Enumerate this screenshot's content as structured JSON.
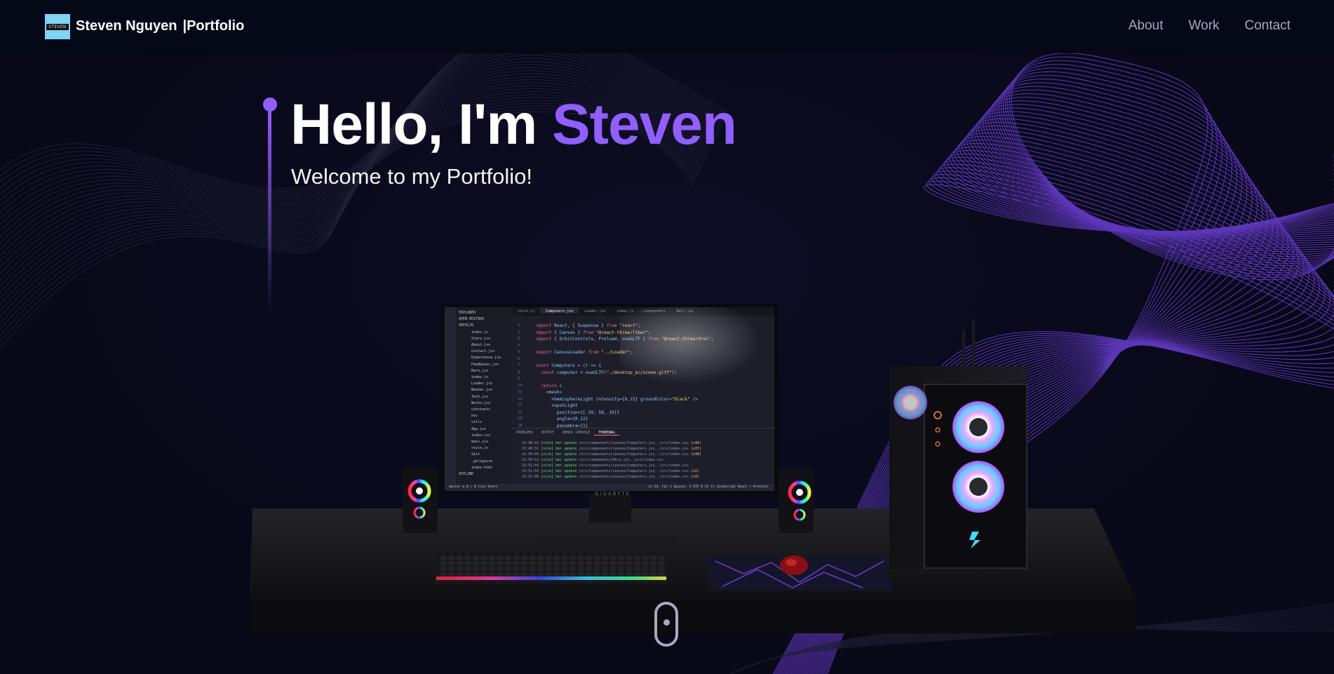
{
  "navbar": {
    "logo_text": "STEVEN",
    "brand_name": "Steven Nguyen",
    "brand_suffix": "|Portfolio",
    "links": [
      "About",
      "Work",
      "Contact"
    ]
  },
  "hero": {
    "greeting": "Hello, I'm ",
    "name": "Steven",
    "subtitle": "Welcome to my Portfolio!"
  },
  "editor": {
    "tabs": [
      "style.js",
      "Computers.jsx",
      "Loader.jsx",
      "index.js .../components",
      "Ball.jsx"
    ],
    "active_tab": "Computers.jsx",
    "explorer_title": "EXPLORER",
    "open_editors": "OPEN EDITORS",
    "project": "3DFOLIO",
    "files": [
      "index.js",
      "Stars.jsx",
      "About.jsx",
      "Contact.jsx",
      "Experience.jsx",
      "Feedbacks.jsx",
      "Hero.jsx",
      "index.js",
      "Loader.jsx",
      "Navbar.jsx",
      "Tech.jsx",
      "Works.jsx",
      "constants",
      "hoc",
      "utils",
      "App.jsx",
      "index.css",
      "main.jsx",
      "style.js",
      "dist",
      ".gitignore",
      "index.html"
    ],
    "outline": "OUTLINE",
    "code_lines": [
      "import React, { Suspense } from \"react\";",
      "import { Canvas } from \"@react-three/fiber\";",
      "import { OrbitControls, Preload, useGLTF } from \"@react-three/drei\";",
      "",
      "import CanvasLoader from \"../Loader\";",
      "",
      "const Computers = () => {",
      "  const computer = useGLTF(\"./desktop_pc/scene.gltf\");",
      "",
      "  return (",
      "    <mesh>",
      "      <hemisphereLight intensity={0.15} groundColor=\"black\" />",
      "      <spotLight",
      "        position={[-20, 50, 10]}",
      "        angle={0.12}",
      "        penumbra={1}"
    ],
    "panel_tabs": [
      "PROBLEMS",
      "OUTPUT",
      "DEBUG CONSOLE",
      "TERMINAL"
    ],
    "active_panel": "TERMINAL",
    "terminal_lines": [
      "22:48:42 [vite] hmr update /src/components/canvas/Computers.jsx, /src/index.css (x35)",
      "22:48:51 [vite] hmr update /src/components/canvas/Computers.jsx, /src/index.css (x37)",
      "22:50:09 [vite] hmr update /src/components/canvas/Computers.jsx, /src/index.css (x38)",
      "22:50:52 [vite] hmr update /src/components/Hero.jsx, /src/index.css",
      "22:51:04 [vite] hmr update /src/components/canvas/Computers.jsx, /src/index.css",
      "22:51:55 [vite] hmr update /src/components/canvas/Computers.jsx, /src/index.css (x2)",
      "22:52:09 [vite] hmr update /src/components/canvas/Computers.jsx, /src/index.css (x3)"
    ],
    "status_left": "master  ⊗ 0 ⚠ 0  Live Share",
    "status_right": "Ln 54, Col 1   Spaces: 2   UTF-8   LF   {} JavaScript React   ✓ Prettier",
    "monitor_brand": "GIGABYTE"
  },
  "colors": {
    "accent": "#915eff",
    "nav_link": "#aaa6c3",
    "background": "#050816",
    "logo_bg": "#7fd3f5"
  }
}
